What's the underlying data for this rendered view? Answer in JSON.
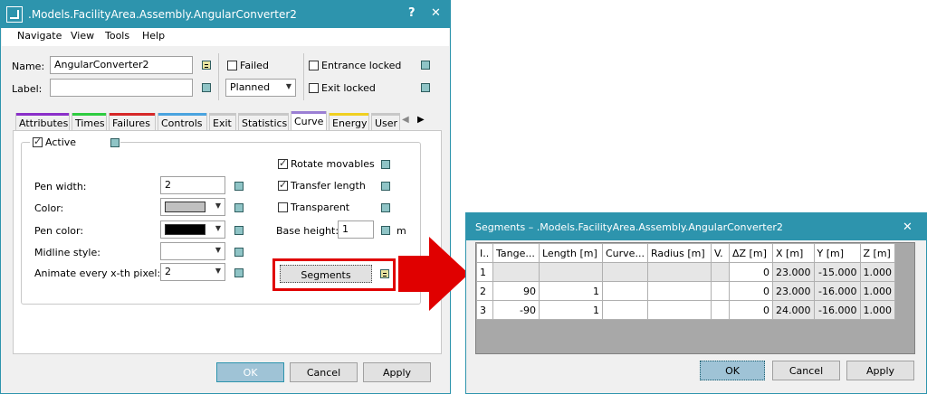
{
  "main_window": {
    "title": ".Models.FacilityArea.Assembly.AngularConverter2",
    "help_button": "?",
    "close_button": "✕",
    "menu": [
      "Navigate",
      "View",
      "Tools",
      "Help"
    ],
    "name_label": "Name:",
    "name_value": "AngularConverter2",
    "label_label": "Label:",
    "label_value": "",
    "failed_label": "Failed",
    "failed_checked": false,
    "planned_value": "Planned",
    "entrance_locked_label": "Entrance locked",
    "entrance_locked_checked": false,
    "exit_locked_label": "Exit locked",
    "exit_locked_checked": false,
    "tabs": [
      {
        "label": "Attributes",
        "color": "#8b2fc9"
      },
      {
        "label": "Times",
        "color": "#2ecc40"
      },
      {
        "label": "Failures",
        "color": "#d62828"
      },
      {
        "label": "Controls",
        "color": "#4aa3df"
      },
      {
        "label": "Exit",
        "color": "#c8c8c8"
      },
      {
        "label": "Statistics",
        "color": "#c8c8c8"
      },
      {
        "label": "Curve",
        "color": "#9b7fd4"
      },
      {
        "label": "Energy",
        "color": "#f0d020"
      },
      {
        "label": "User",
        "color": "#c8c8c8"
      }
    ],
    "selected_tab": "Curve",
    "curve": {
      "active_label": "Active",
      "active_checked": true,
      "pen_width_label": "Pen width:",
      "pen_width_value": "2",
      "color_label": "Color:",
      "color_value": "#c0c0c0",
      "pen_color_label": "Pen color:",
      "pen_color_value": "#000000",
      "midline_style_label": "Midline style:",
      "midline_style_value": "",
      "animate_label": "Animate every x-th pixel:",
      "animate_value": "2",
      "rotate_movables_label": "Rotate movables",
      "rotate_movables_checked": true,
      "transfer_length_label": "Transfer length",
      "transfer_length_checked": true,
      "transparent_label": "Transparent",
      "transparent_checked": false,
      "base_height_label": "Base height:",
      "base_height_value": "1",
      "base_height_unit": "m",
      "segments_button": "Segments"
    },
    "ok_button": "OK",
    "cancel_button": "Cancel",
    "apply_button": "Apply"
  },
  "segments_window": {
    "title": "Segments – .Models.FacilityArea.Assembly.AngularConverter2",
    "close_button": "✕",
    "columns": [
      "I..",
      "Tange...",
      "Length [m]",
      "Curve...",
      "Radius [m]",
      "V.",
      "ΔZ [m]",
      "X [m]",
      "Y [m]",
      "Z [m]"
    ],
    "rows": [
      [
        "1",
        "",
        "",
        "",
        "",
        "",
        "0",
        "23.000",
        "-15.000",
        "1.000"
      ],
      [
        "2",
        "90",
        "1",
        "",
        "",
        "",
        "0",
        "23.000",
        "-16.000",
        "1.000"
      ],
      [
        "3",
        "-90",
        "1",
        "",
        "",
        "",
        "0",
        "24.000",
        "-16.000",
        "1.000"
      ]
    ],
    "ok_button": "OK",
    "cancel_button": "Cancel",
    "apply_button": "Apply"
  }
}
